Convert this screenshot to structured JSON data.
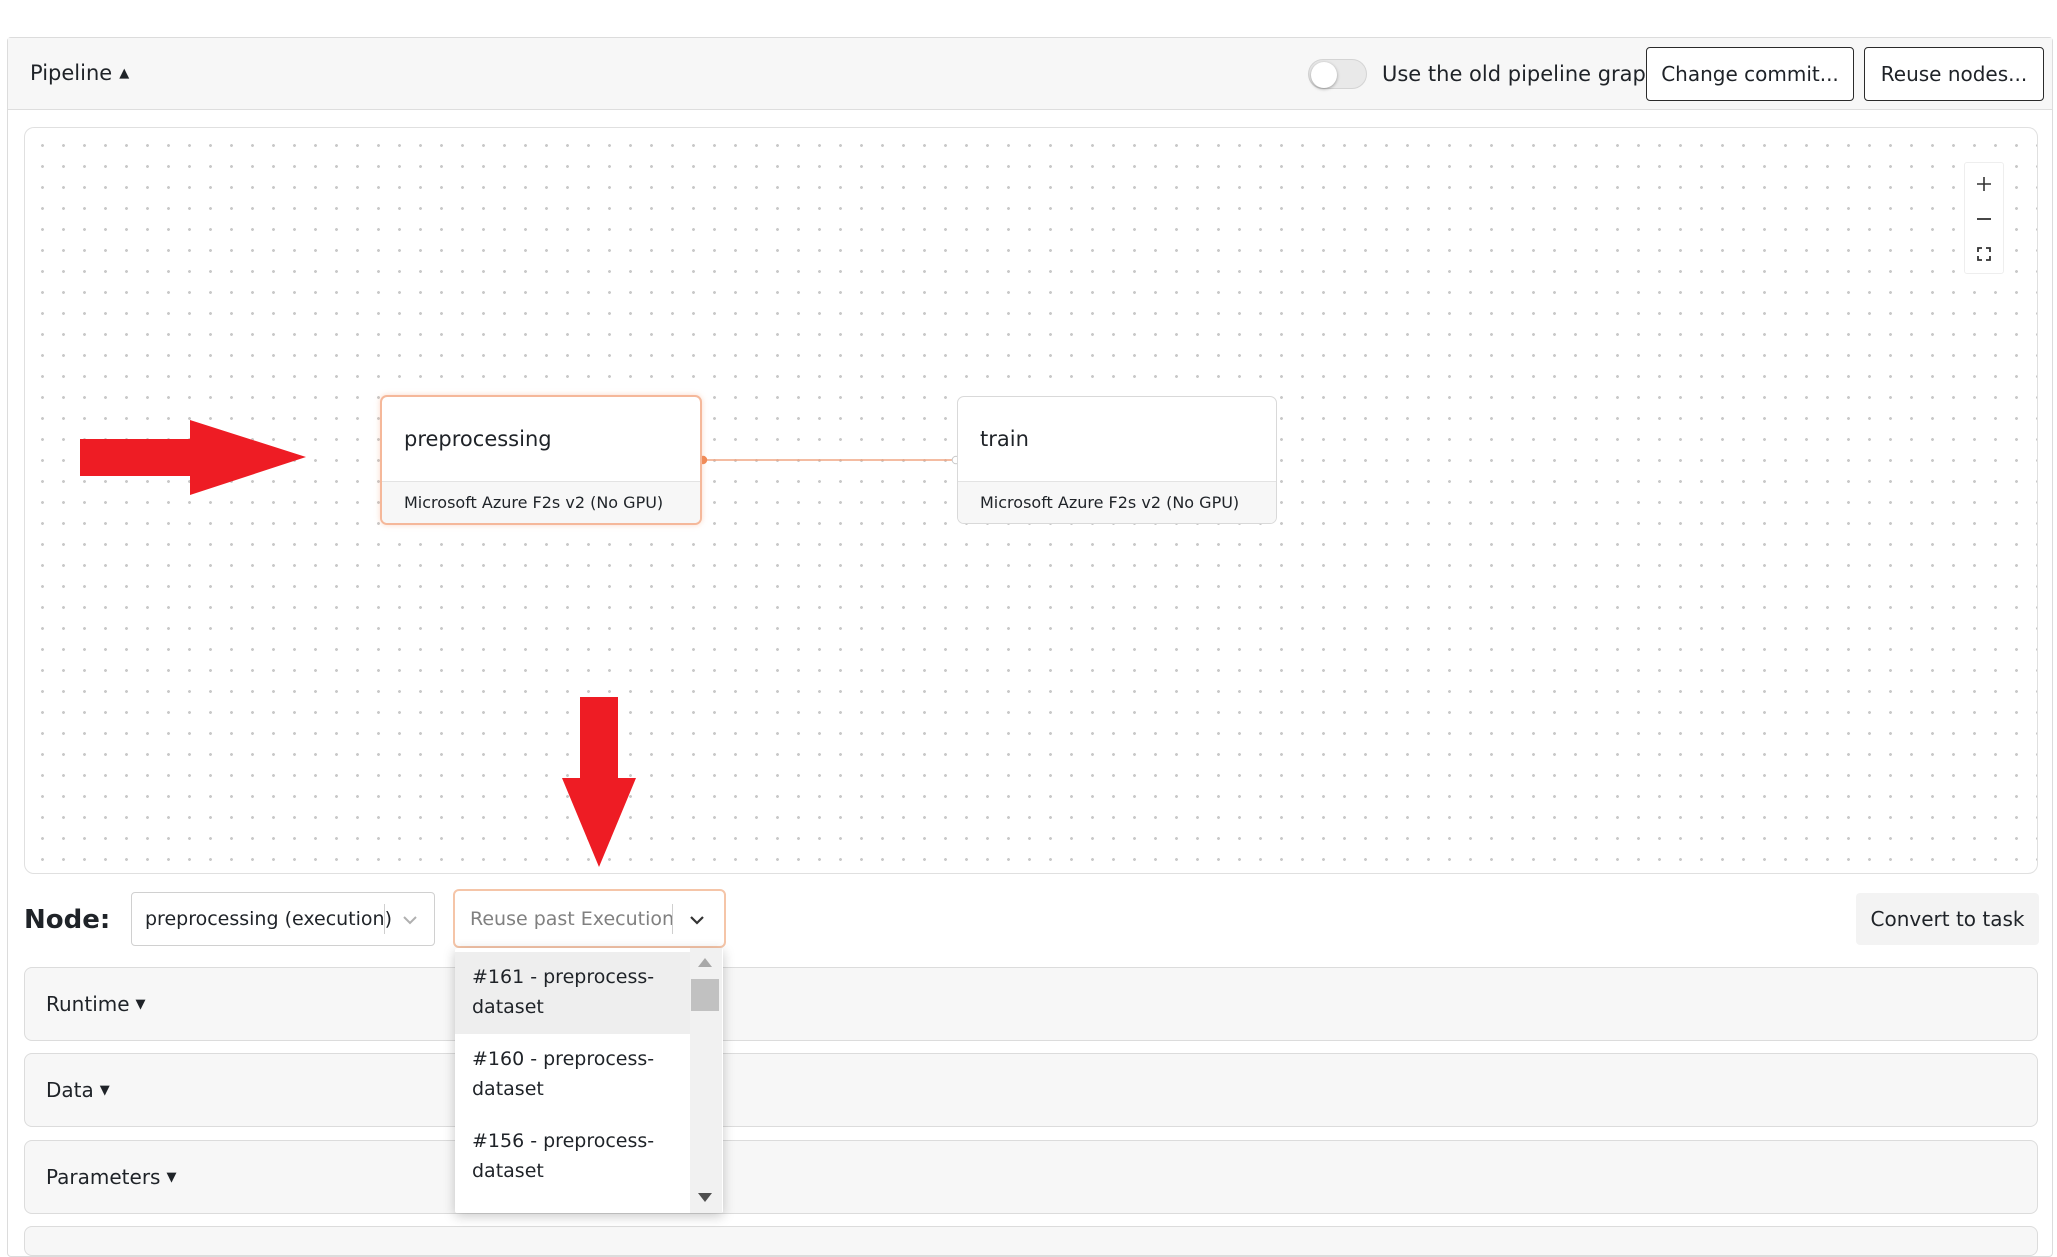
{
  "header": {
    "pipeline_label": "Pipeline",
    "old_graph_toggle_label": "Use the old pipeline graph",
    "old_graph_toggle_on": false,
    "change_commit_label": "Change commit...",
    "reuse_nodes_label": "Reuse nodes..."
  },
  "graph": {
    "zoom_controls": [
      "plus-icon",
      "minus-icon",
      "fit-view-icon"
    ],
    "nodes": [
      {
        "name": "preprocessing",
        "machine": "Microsoft Azure F2s v2 (No GPU)",
        "selected": true
      },
      {
        "name": "train",
        "machine": "Microsoft Azure F2s v2 (No GPU)",
        "selected": false
      }
    ],
    "edge": {
      "from": "preprocessing",
      "to": "train"
    },
    "annotations": [
      "right-arrow",
      "down-arrow"
    ],
    "annotation_color": "#ee1c24",
    "accent_color": "#f5a37e"
  },
  "node_panel": {
    "label": "Node:",
    "node_select_value": "preprocessing (execution)",
    "reuse_select_placeholder": "Reuse past Execution",
    "convert_label": "Convert to task",
    "dropdown_options": [
      {
        "line1": "#161 - preprocess-",
        "line2": "dataset"
      },
      {
        "line1": "#160 - preprocess-",
        "line2": "dataset"
      },
      {
        "line1": "#156 - preprocess-",
        "line2": "dataset"
      }
    ]
  },
  "sections": [
    {
      "label": "Runtime"
    },
    {
      "label": "Data"
    },
    {
      "label": "Parameters"
    }
  ]
}
